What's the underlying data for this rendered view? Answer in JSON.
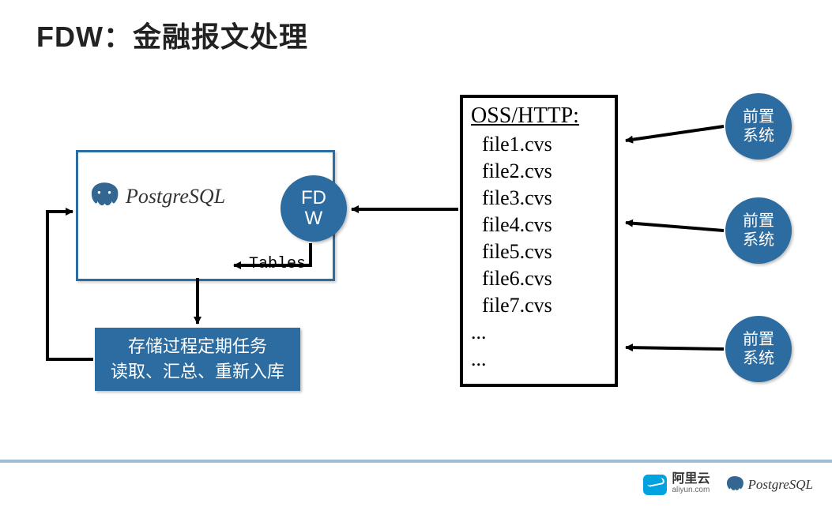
{
  "title_prefix": "FDW",
  "title_sep": "：",
  "title_rest": "金融报文处理",
  "pg_label": "PostgreSQL",
  "tables_label": "Tables",
  "fdw_label": "FD\nW",
  "proc_line1": "存储过程定期任务",
  "proc_line2": "读取、汇总、重新入库",
  "files_header": "OSS/HTTP:",
  "files": [
    "file1.cvs",
    "file2.cvs",
    "file3.cvs",
    "file4.cvs",
    "file5.cvs",
    "file6.cvs",
    "file7.cvs"
  ],
  "files_dots": "...",
  "front_label": "前置\n系统",
  "footer_aliyun_name": "阿里云",
  "footer_aliyun_domain": "aliyun.com",
  "footer_pg": "PostgreSQL"
}
